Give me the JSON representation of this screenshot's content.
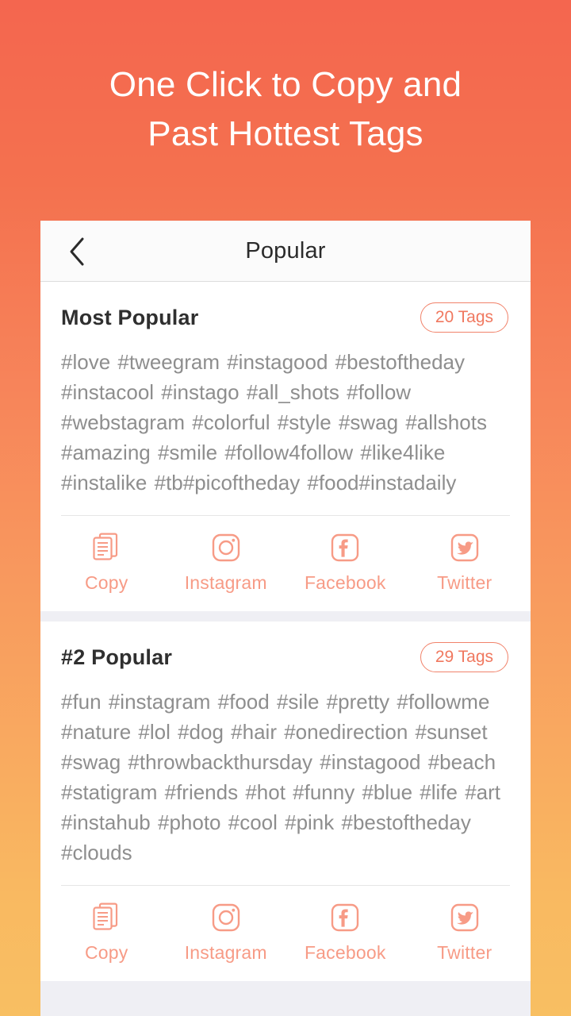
{
  "headline": {
    "line1": "One Click to Copy and",
    "line2": "Past Hottest Tags"
  },
  "navbar": {
    "title": "Popular",
    "back_icon": "chevron-left-icon"
  },
  "colors": {
    "accent": "#f0785f",
    "accent_light": "#f79b86",
    "gradient_top": "#f4664f",
    "gradient_bottom": "#f8bf62",
    "card_bg": "#ffffff",
    "page_bg": "#efeff4",
    "tag_text": "#8e8e8e",
    "title_text": "#2f2f2f"
  },
  "actions": [
    {
      "label": "Copy",
      "icon": "copy-icon"
    },
    {
      "label": "Instagram",
      "icon": "instagram-icon"
    },
    {
      "label": "Facebook",
      "icon": "facebook-icon"
    },
    {
      "label": "Twitter",
      "icon": "twitter-icon"
    }
  ],
  "cards": [
    {
      "title": "Most Popular",
      "badge": "20 Tags",
      "tags": "#love #tweegram #instagood #bestoftheday #instacool #instago #all_shots #follow #webstagram #colorful #style #swag #allshots #amazing #smile #follow4follow #like4like #instalike #tb#picoftheday #food#instadaily"
    },
    {
      "title": "#2 Popular",
      "badge": "29 Tags",
      "tags": "#fun #instagram #food #sile #pretty #followme #nature #lol #dog #hair #onedirection #sunset #swag #throwbackthursday #instagood #beach #statigram #friends #hot #funny #blue #life #art #instahub #photo #cool #pink #bestoftheday #clouds"
    }
  ]
}
